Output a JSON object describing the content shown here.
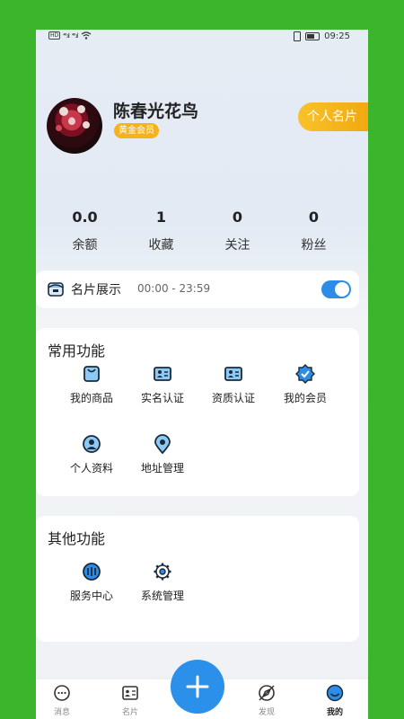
{
  "status_bar": {
    "hd": "HD",
    "signal1": "⁴⁶.ıl",
    "signal2": "⁴⁶.ıl",
    "time": "09:25"
  },
  "profile": {
    "name": "陈春光花鸟",
    "vip_label": "黄金会员",
    "card_button": "个人名片"
  },
  "stats": [
    {
      "value": "0.0",
      "label": "余额"
    },
    {
      "value": "1",
      "label": "收藏"
    },
    {
      "value": "0",
      "label": "关注"
    },
    {
      "value": "0",
      "label": "粉丝"
    }
  ],
  "showcase": {
    "title": "名片展示",
    "time": "00:00 - 23:59",
    "enabled": true
  },
  "common_functions": {
    "title": "常用功能",
    "items": [
      {
        "label": "我的商品",
        "icon": "shopping-bag-icon"
      },
      {
        "label": "实名认证",
        "icon": "id-card-icon"
      },
      {
        "label": "资质认证",
        "icon": "certificate-icon"
      },
      {
        "label": "我的会员",
        "icon": "membership-badge-icon"
      },
      {
        "label": "个人资料",
        "icon": "profile-icon"
      },
      {
        "label": "地址管理",
        "icon": "location-pin-icon"
      }
    ]
  },
  "other_functions": {
    "title": "其他功能",
    "items": [
      {
        "label": "服务中心",
        "icon": "service-center-icon"
      },
      {
        "label": "系统管理",
        "icon": "settings-gear-icon"
      }
    ]
  },
  "tabbar": {
    "items": [
      {
        "label": "消息",
        "icon": "message-icon"
      },
      {
        "label": "名片",
        "icon": "card-icon"
      },
      {
        "label": "发现",
        "icon": "discover-icon"
      },
      {
        "label": "我的",
        "icon": "me-icon",
        "active": true
      }
    ],
    "fab_icon": "plus-icon"
  },
  "colors": {
    "background": "#3ab52c",
    "accent_blue": "#2b90ea",
    "gold": "#f5b21a"
  }
}
